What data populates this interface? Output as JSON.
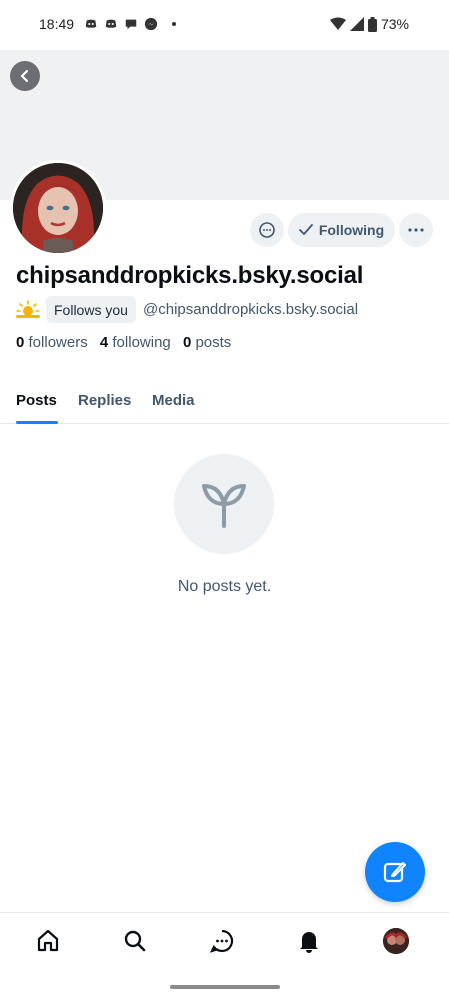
{
  "status_bar": {
    "time": "18:49",
    "battery": "73%",
    "left_icons": [
      "discord-icon",
      "discord-icon",
      "chat-bubble-icon",
      "messenger-icon"
    ],
    "right_icons": [
      "wifi-icon",
      "signal-icon",
      "battery-icon"
    ]
  },
  "profile": {
    "display_name": "chipsanddropkicks.bsky.social",
    "handle": "@chipsanddropkicks.bsky.social",
    "follows_you_label": "Follows you",
    "following_button_label": "Following",
    "status_emoji": "sun-behind-cloud-icon",
    "stats": {
      "followers_count": "0",
      "followers_label": "followers",
      "following_count": "4",
      "following_label": "following",
      "posts_count": "0",
      "posts_label": "posts"
    }
  },
  "tabs": [
    {
      "label": "Posts",
      "active": true
    },
    {
      "label": "Replies",
      "active": false
    },
    {
      "label": "Media",
      "active": false
    }
  ],
  "empty_state": {
    "message": "No posts yet.",
    "icon": "sprout-icon"
  },
  "bottom_nav": [
    "home-icon",
    "search-icon",
    "chat-icon",
    "bell-icon",
    "profile-avatar"
  ],
  "colors": {
    "accent": "#1083fe",
    "muted_text": "#42576c",
    "chip_bg": "#eef1f4"
  }
}
